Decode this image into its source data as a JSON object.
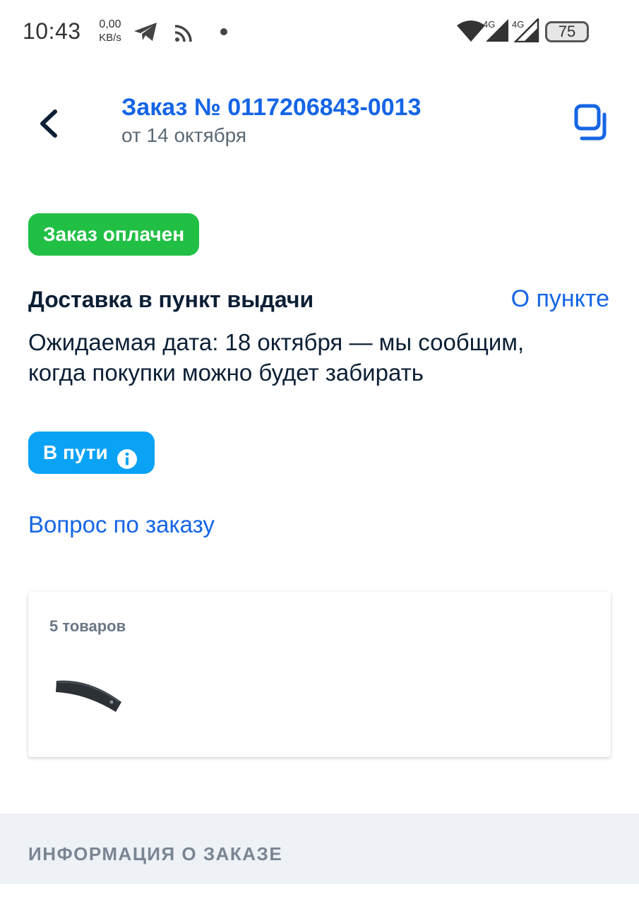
{
  "status_bar": {
    "time": "10:43",
    "speed_value": "0,00",
    "speed_unit": "KB/s",
    "network_1": "4G",
    "network_2": "4G",
    "battery": "75",
    "icons": [
      "telegram-icon",
      "cast-icon",
      "notification-dot-icon",
      "wifi-icon",
      "signal-icon",
      "signal-icon",
      "battery-icon"
    ]
  },
  "header": {
    "title": "Заказ № 0117206843-0013",
    "subtitle": "от 14 октября",
    "back_icon": "chevron-left-icon",
    "copy_icon": "copy-icon"
  },
  "order_status": {
    "label": "Заказ оплачен",
    "color": "#21c045"
  },
  "delivery": {
    "title": "Доставка в пункт выдачи",
    "pickup_link": "О пункте",
    "expected_text": "Ожидаемая дата: 18 октября — мы сообщим, когда покупки можно будет забирать"
  },
  "transit_status": {
    "label": "В пути",
    "color": "#0aa2f5",
    "icon": "info-icon"
  },
  "question_link": "Вопрос по заказу",
  "goods": {
    "count_label": "5 товаров",
    "items": [
      {
        "image": "curved-magazine-product-image"
      }
    ]
  },
  "info_section": {
    "title": "ИНФОРМАЦИЯ О ЗАКАЗЕ"
  },
  "colors": {
    "accent": "#1565e6",
    "text": "#0b1f35",
    "muted": "#5b6975",
    "section_bg": "#eef2f7"
  }
}
